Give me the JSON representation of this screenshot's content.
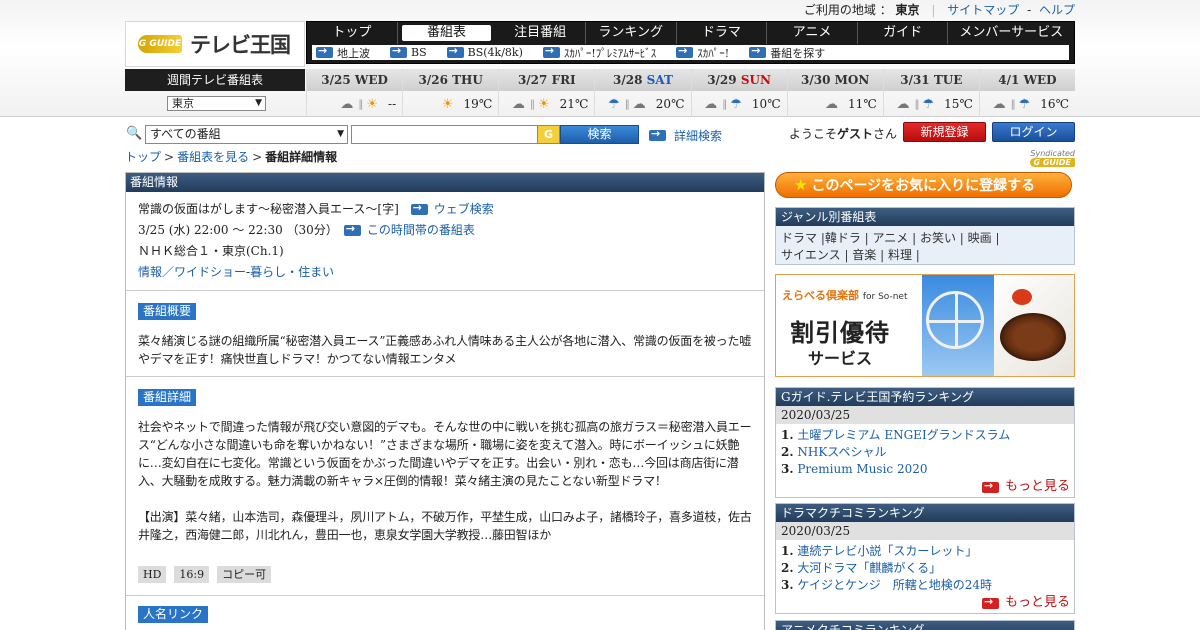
{
  "util": {
    "region_label": "ご利用の地域 ：",
    "region_value": "東京",
    "sitemap": "サイトマップ",
    "dash": "-",
    "help": "ヘルプ"
  },
  "logo": {
    "mark": "G GUIDE",
    "text": "テレビ王国"
  },
  "nav": {
    "items": [
      "トップ",
      "番組表",
      "注目番組",
      "ランキング",
      "ドラマ",
      "アニメ",
      "ガイド",
      "メンバーサービス"
    ],
    "sub": [
      "地上波",
      "BS",
      "BS(4k/8k)",
      "ｽｶﾊﾟｰ!ﾌﾟﾚﾐｱﾑｻｰﾋﾞｽ",
      "ｽｶﾊﾟｰ!",
      "番組を探す"
    ]
  },
  "week": {
    "label": "週間テレビ番組表",
    "region": "東京",
    "days": [
      {
        "date": "3/25",
        "wd": "WED",
        "cls": "",
        "icons": [
          "cloud",
          "sep",
          "sun"
        ],
        "temp": "--"
      },
      {
        "date": "3/26",
        "wd": "THU",
        "cls": "",
        "icons": [
          "sun"
        ],
        "temp": "19℃"
      },
      {
        "date": "3/27",
        "wd": "FRI",
        "cls": "",
        "icons": [
          "cloud",
          "sep",
          "sun"
        ],
        "temp": "21℃"
      },
      {
        "date": "3/28",
        "wd": "SAT",
        "cls": "sat",
        "icons": [
          "umb",
          "sep",
          "cloud"
        ],
        "temp": "20℃"
      },
      {
        "date": "3/29",
        "wd": "SUN",
        "cls": "sun",
        "icons": [
          "cloud",
          "sep",
          "umb"
        ],
        "temp": "10℃"
      },
      {
        "date": "3/30",
        "wd": "MON",
        "cls": "",
        "icons": [
          "cloud"
        ],
        "temp": "11℃"
      },
      {
        "date": "3/31",
        "wd": "TUE",
        "cls": "",
        "icons": [
          "cloud",
          "sep",
          "umb"
        ],
        "temp": "15℃"
      },
      {
        "date": "4/1",
        "wd": "WED",
        "cls": "",
        "icons": [
          "cloud",
          "sep",
          "umb"
        ],
        "temp": "16℃"
      }
    ]
  },
  "search": {
    "category": "すべての番組",
    "query": "",
    "g_mark": "G",
    "button": "検索",
    "advanced": "詳細検索"
  },
  "account": {
    "welcome_pre": "ようこそ",
    "guest": "ゲスト",
    "welcome_post": "さん",
    "register": "新規登録",
    "login": "ログイン",
    "syndicated": "Syndicated",
    "syndicated_mark": "G GUIDE"
  },
  "breadcrumb": {
    "top": "トップ",
    "schedule": "番組表を見る",
    "gt": ">",
    "current": "番組詳細情報"
  },
  "program": {
    "header": "番組情報",
    "title": "常識の仮面はがします～秘密潜入員エース～[字]",
    "web_search": "ウェブ検索",
    "datetime": "3/25 (水) 22:00 ～ 22:30 （30分）",
    "timeslot_link": "この時間帯の番組表",
    "channel": "ＮＨＫ総合１・東京(Ch.1)",
    "genre1": "情報／ワイドショー",
    "genre_sep": " - ",
    "genre2": "暮らし・住まい",
    "summary_label": "番組概要",
    "summary": "菜々緒演じる謎の組織所属“秘密潜入員エース”正義感あふれ人情味ある主人公が各地に潜入、常識の仮面を被った嘘やデマを正す！痛快世直しドラマ！かつてない情報エンタメ",
    "detail_label": "番組詳細",
    "detail": "社会やネットで間違った情報が飛び交い意図的デマも。そんな世の中に戦いを挑む孤高の旅ガラス＝秘密潜入員エース“どんな小さな間違いも命を奪いかねない！”さまざまな場所・職場に姿を変えて潜入。時にボーイッシュに妖艶に…変幻自在に七変化。常識という仮面をかぶった間違いやデマを正す。出会い・別れ・恋も…今回は商店街に潜入、大騒動を成敗する。魅力満載の新キャラ×圧倒的情報！菜々緒主演の見たことない新型ドラマ！",
    "cast": "【出演】菜々緒，山本浩司，森優理斗，夙川アトム，不破万作，平埜生成，山口みよ子，諸橋玲子，喜多道枝，佐古井隆之，西海健二郎，川北れん，豊田一也，恵泉女学園大学教授…藤田智ほか",
    "tags": [
      "HD",
      "16:9",
      "コピー可"
    ],
    "person_label": "人名リンク"
  },
  "sidebar": {
    "favorite": "このページをお気に入りに登録する",
    "genre_header": "ジャンル別番組表",
    "genre_line1": "ドラマ |韓ドラ | アニメ | お笑い | 映画 |",
    "genre_line2": "サイエンス | 音楽 | 料理 |",
    "ad": {
      "top": "えらべる倶楽部",
      "top_sub": "for So-net",
      "main": "割引優待",
      "sub": "サービス"
    },
    "rank1": {
      "header": "Gガイド.テレビ王国予約ランキング",
      "date": "2020/03/25",
      "items": [
        "土曜プレミアム ENGEIグランドスラム",
        "NHKスペシャル",
        "Premium Music 2020"
      ],
      "more": "もっと見る"
    },
    "rank2": {
      "header": "ドラマクチコミランキング",
      "date": "2020/03/25",
      "items": [
        "連続テレビ小説「スカーレット」",
        "大河ドラマ「麒麟がくる」",
        "ケイジとケンジ　所轄と地検の24時"
      ],
      "more": "もっと見る"
    },
    "rank3_header": "アニメクチコミランキング"
  }
}
